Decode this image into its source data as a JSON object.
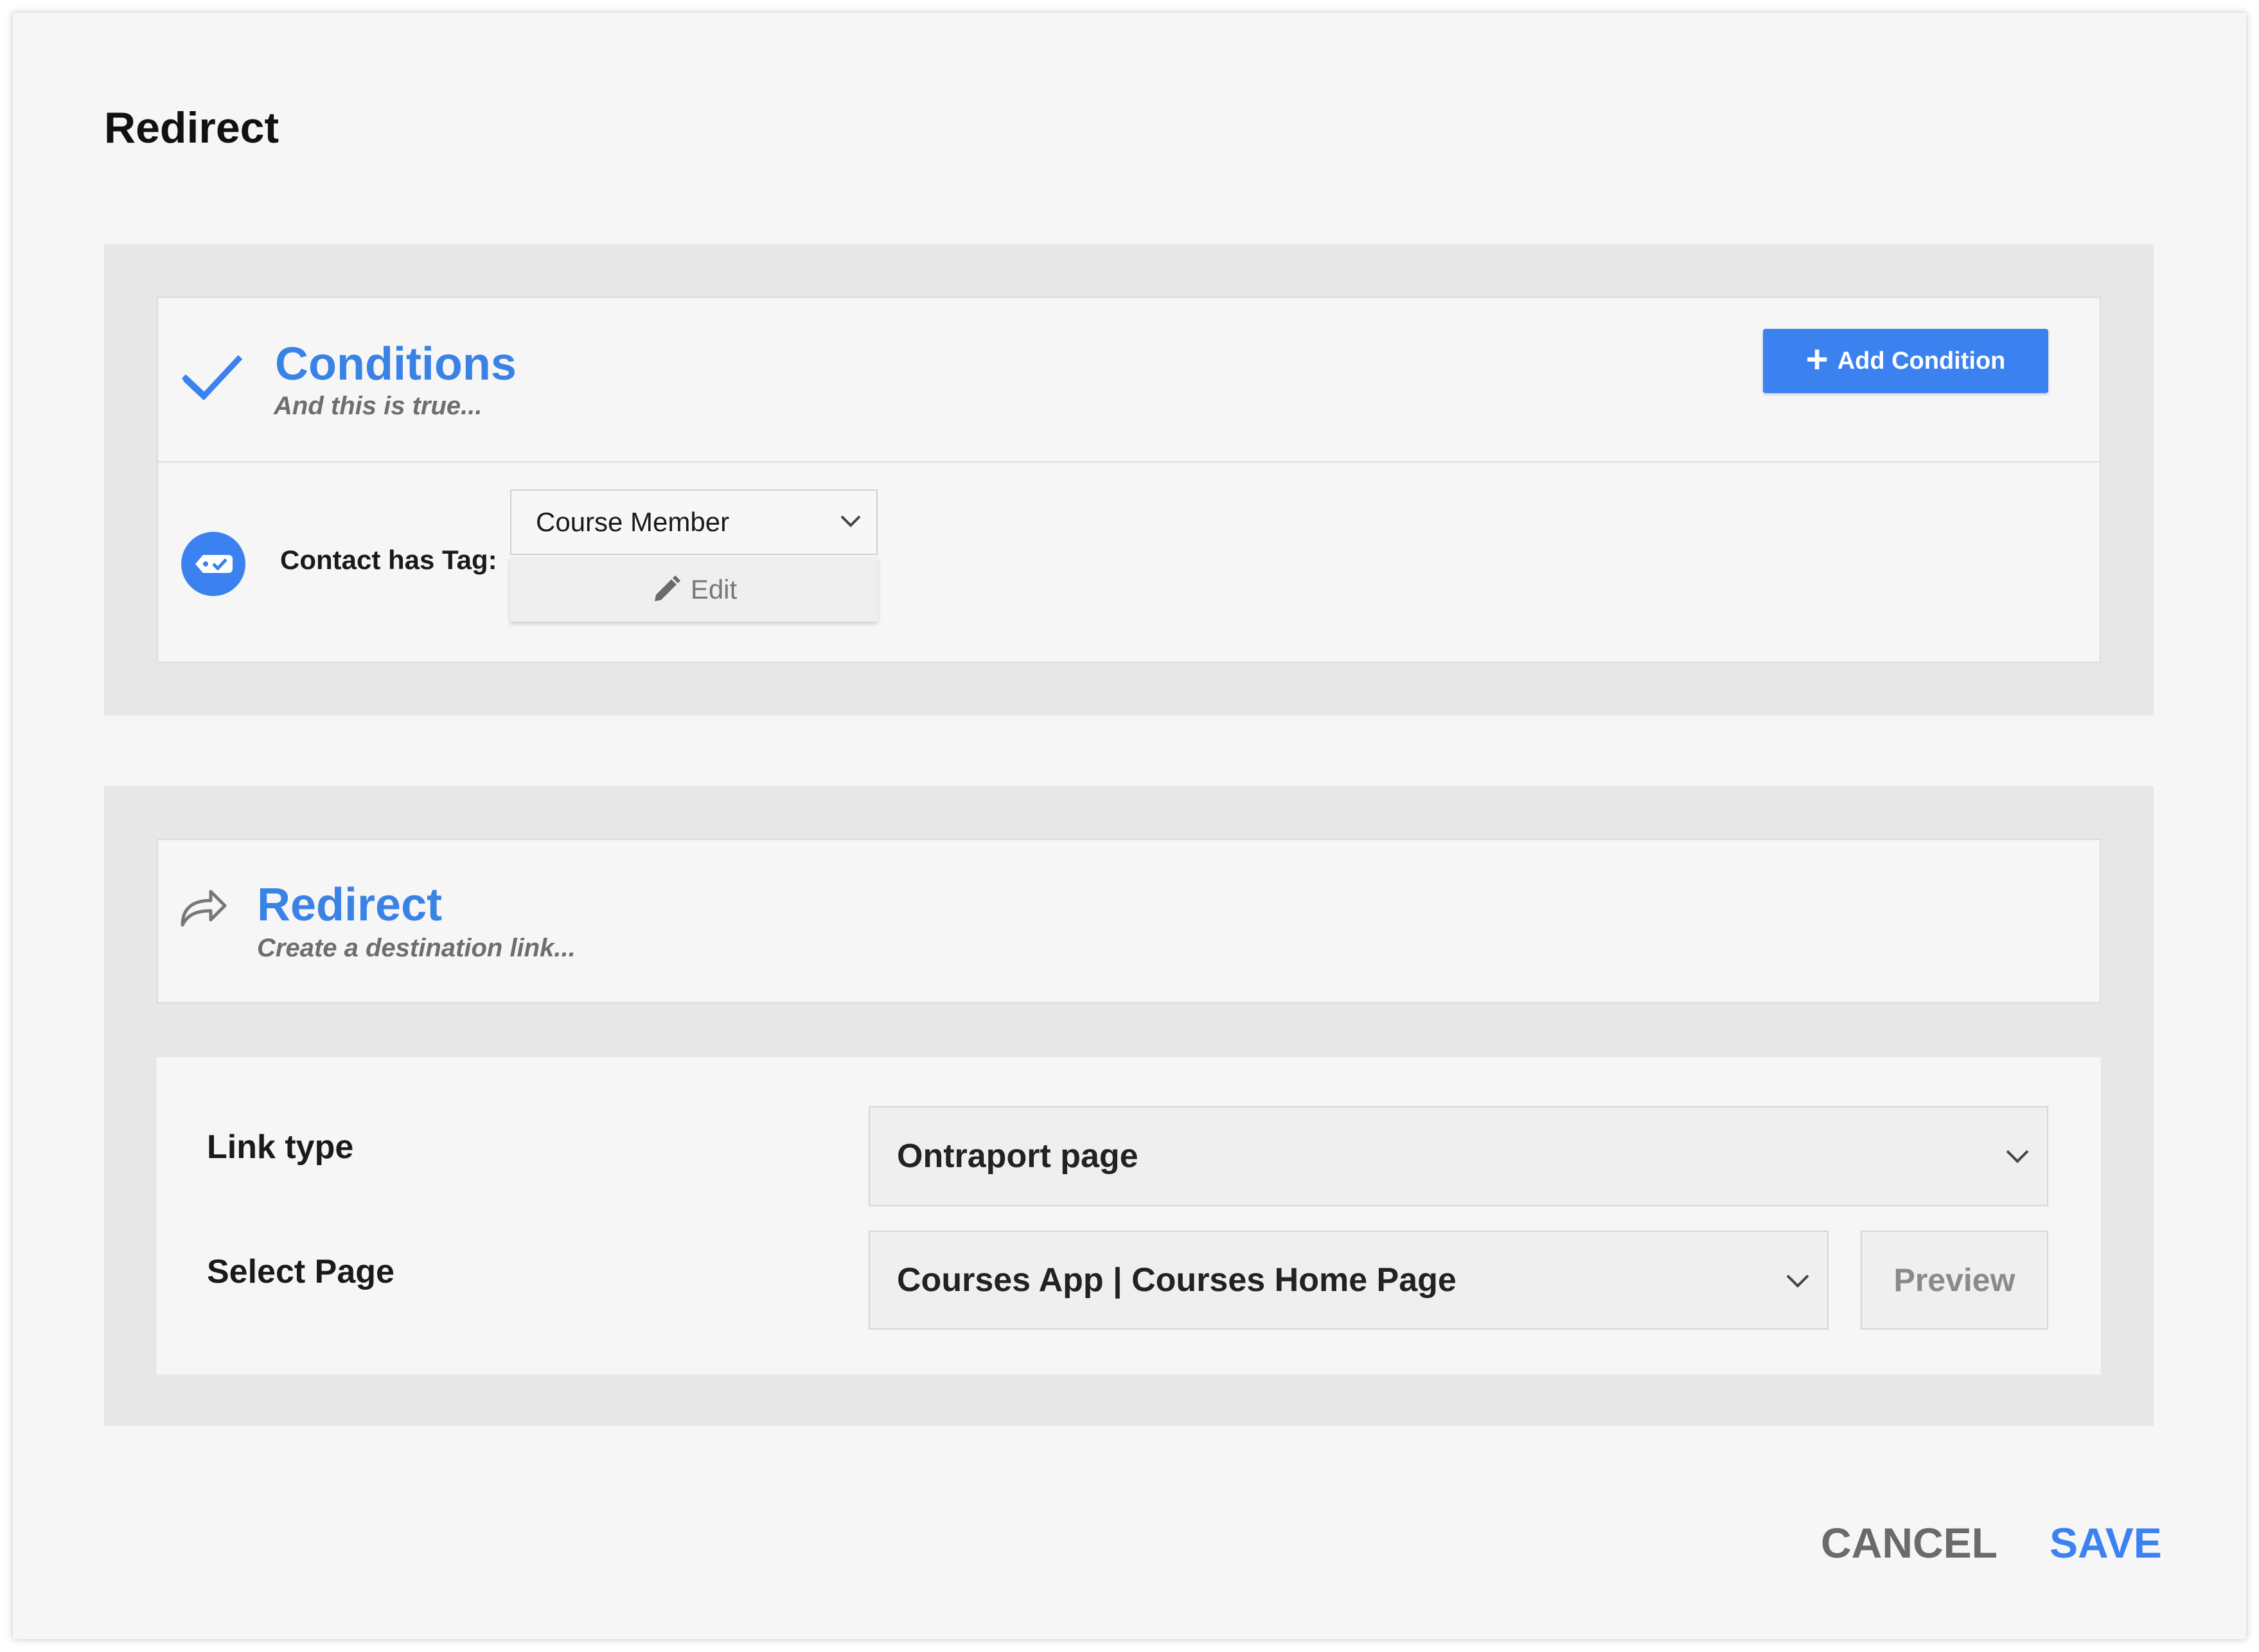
{
  "modal": {
    "title": "Redirect"
  },
  "conditions": {
    "title": "Conditions",
    "subtitle": "And this is true...",
    "add_button_label": "Add Condition",
    "row": {
      "label": "Contact has Tag:",
      "selected_tag": "Course Member",
      "edit_label": "Edit"
    }
  },
  "redirect": {
    "title": "Redirect",
    "subtitle": "Create a destination link...",
    "link_type_label": "Link type",
    "link_type_value": "Ontraport page",
    "select_page_label": "Select Page",
    "select_page_value": "Courses App | Courses Home Page",
    "preview_label": "Preview"
  },
  "footer": {
    "cancel_label": "CANCEL",
    "save_label": "SAVE"
  },
  "colors": {
    "accent": "#3b82f0",
    "background": "#f6f6f6",
    "panel": "#e7e7e7"
  },
  "icons": [
    "check-icon",
    "tag-check-icon",
    "plus-icon",
    "chevron-down-icon",
    "pencil-icon",
    "redirect-arrow-icon"
  ]
}
